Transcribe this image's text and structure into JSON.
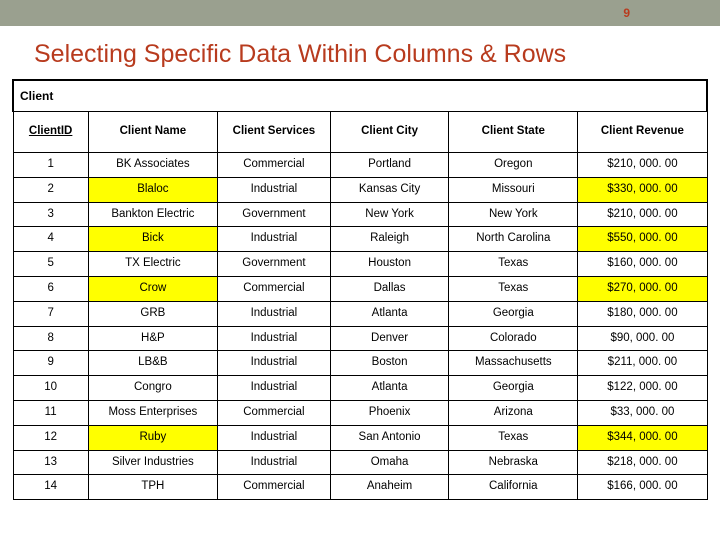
{
  "page_number": "9",
  "title": "Selecting Specific Data Within Columns & Rows",
  "table": {
    "group_header": "Client",
    "columns": [
      "ClientID",
      "Client Name",
      "Client Services",
      "Client City",
      "Client State",
      "Client Revenue"
    ],
    "rows": [
      {
        "id": "1",
        "name": "BK Associates",
        "services": "Commercial",
        "city": "Portland",
        "state": "Oregon",
        "revenue": "$210, 000. 00",
        "hl": false
      },
      {
        "id": "2",
        "name": "Blaloc",
        "services": "Industrial",
        "city": "Kansas City",
        "state": "Missouri",
        "revenue": "$330, 000. 00",
        "hl": true
      },
      {
        "id": "3",
        "name": "Bankton Electric",
        "services": "Government",
        "city": "New York",
        "state": "New York",
        "revenue": "$210, 000. 00",
        "hl": false
      },
      {
        "id": "4",
        "name": "Bick",
        "services": "Industrial",
        "city": "Raleigh",
        "state": "North Carolina",
        "revenue": "$550, 000. 00",
        "hl": true
      },
      {
        "id": "5",
        "name": "TX Electric",
        "services": "Government",
        "city": "Houston",
        "state": "Texas",
        "revenue": "$160, 000. 00",
        "hl": false
      },
      {
        "id": "6",
        "name": "Crow",
        "services": "Commercial",
        "city": "Dallas",
        "state": "Texas",
        "revenue": "$270, 000. 00",
        "hl": true
      },
      {
        "id": "7",
        "name": "GRB",
        "services": "Industrial",
        "city": "Atlanta",
        "state": "Georgia",
        "revenue": "$180, 000. 00",
        "hl": false
      },
      {
        "id": "8",
        "name": "H&P",
        "services": "Industrial",
        "city": "Denver",
        "state": "Colorado",
        "revenue": "$90, 000. 00",
        "hl": false
      },
      {
        "id": "9",
        "name": "LB&B",
        "services": "Industrial",
        "city": "Boston",
        "state": "Massachusetts",
        "revenue": "$211, 000. 00",
        "hl": false
      },
      {
        "id": "10",
        "name": "Congro",
        "services": "Industrial",
        "city": "Atlanta",
        "state": "Georgia",
        "revenue": "$122, 000. 00",
        "hl": false
      },
      {
        "id": "11",
        "name": "Moss Enterprises",
        "services": "Commercial",
        "city": "Phoenix",
        "state": "Arizona",
        "revenue": "$33, 000. 00",
        "hl": false
      },
      {
        "id": "12",
        "name": "Ruby",
        "services": "Industrial",
        "city": "San Antonio",
        "state": "Texas",
        "revenue": "$344, 000. 00",
        "hl": true
      },
      {
        "id": "13",
        "name": "Silver Industries",
        "services": "Industrial",
        "city": "Omaha",
        "state": "Nebraska",
        "revenue": "$218, 000. 00",
        "hl": false
      },
      {
        "id": "14",
        "name": "TPH",
        "services": "Commercial",
        "city": "Anaheim",
        "state": "California",
        "revenue": "$166, 000. 00",
        "hl": false
      }
    ]
  }
}
